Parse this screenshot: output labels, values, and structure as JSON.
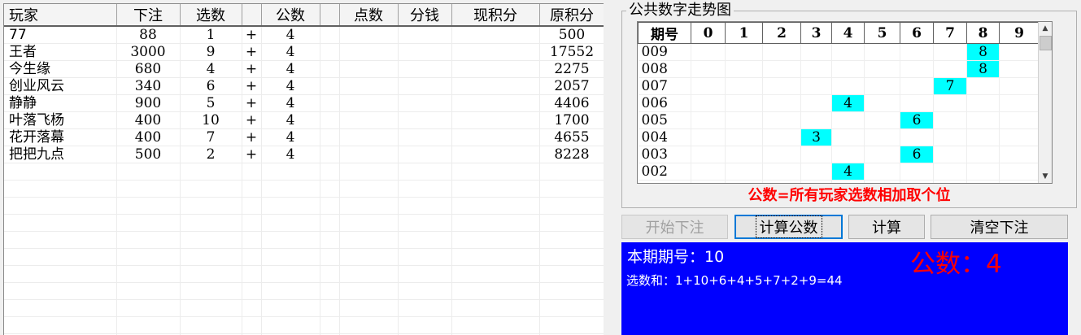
{
  "players_table": {
    "headers": [
      "玩家",
      "下注",
      "选数",
      "",
      "公数",
      "",
      "点数",
      "分钱",
      "现积分",
      "原积分"
    ],
    "rows": [
      {
        "player": "77",
        "bet": "88",
        "pick": "1",
        "op": "+",
        "common": "4",
        "points": "",
        "share": "",
        "current": "",
        "original": "500"
      },
      {
        "player": "王者",
        "bet": "3000",
        "pick": "9",
        "op": "+",
        "common": "4",
        "points": "",
        "share": "",
        "current": "",
        "original": "17552"
      },
      {
        "player": "今生缘",
        "bet": "680",
        "pick": "4",
        "op": "+",
        "common": "4",
        "points": "",
        "share": "",
        "current": "",
        "original": "2275"
      },
      {
        "player": "创业风云",
        "bet": "340",
        "pick": "6",
        "op": "+",
        "common": "4",
        "points": "",
        "share": "",
        "current": "",
        "original": "2057"
      },
      {
        "player": "静静",
        "bet": "900",
        "pick": "5",
        "op": "+",
        "common": "4",
        "points": "",
        "share": "",
        "current": "",
        "original": "4406"
      },
      {
        "player": "叶落飞杨",
        "bet": "400",
        "pick": "10",
        "op": "+",
        "common": "4",
        "points": "",
        "share": "",
        "current": "",
        "original": "1700"
      },
      {
        "player": "花开落幕",
        "bet": "400",
        "pick": "7",
        "op": "+",
        "common": "4",
        "points": "",
        "share": "",
        "current": "",
        "original": "4655"
      },
      {
        "player": "把把九点",
        "bet": "500",
        "pick": "2",
        "op": "+",
        "common": "4",
        "points": "",
        "share": "",
        "current": "",
        "original": "8228"
      }
    ]
  },
  "trend": {
    "title": "公共数字走势图",
    "headers": [
      "期号",
      "0",
      "1",
      "2",
      "3",
      "4",
      "5",
      "6",
      "7",
      "8",
      "9"
    ],
    "rows": [
      {
        "period": "009",
        "value": 8
      },
      {
        "period": "008",
        "value": 8
      },
      {
        "period": "007",
        "value": 7
      },
      {
        "period": "006",
        "value": 4
      },
      {
        "period": "005",
        "value": 6
      },
      {
        "period": "004",
        "value": 3
      },
      {
        "period": "003",
        "value": 6
      },
      {
        "period": "002",
        "value": 4
      }
    ],
    "formula": "公数=所有玩家选数相加取个位",
    "hit_color": "#00ffff"
  },
  "buttons": {
    "start_bet": "开始下注",
    "calc_common": "计算公数",
    "calculate": "计算",
    "clear_bets": "清空下注"
  },
  "info": {
    "period_label": "本期期号：10",
    "sum_label": "选数和：1+10+6+4+5+7+2+9=44",
    "common_label": "公数：",
    "common_value": "4",
    "panel_color": "#0000ff",
    "accent_color": "#ff0000"
  },
  "icons": {
    "scroll_up": "triangle-up",
    "scroll_down": "triangle-down"
  }
}
